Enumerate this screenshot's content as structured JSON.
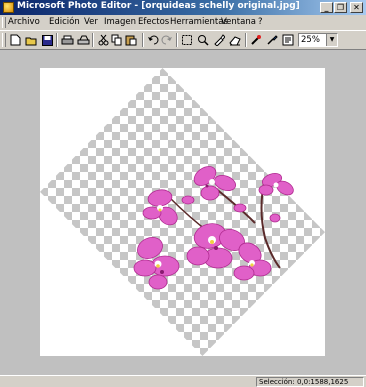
{
  "window": {
    "title": "Microsoft Photo Editor - [orquideas schelly original.jpg]",
    "controls": {
      "minimize": "_",
      "restore": "❐",
      "close": "✕"
    }
  },
  "menu": {
    "items": [
      "Archivo",
      "Edición",
      "Ver",
      "Imagen",
      "Efectos",
      "Herramientas",
      "Ventana",
      "?"
    ]
  },
  "toolbar": {
    "icons": [
      "new-icon",
      "open-icon",
      "save-icon",
      "print-icon",
      "scan-icon",
      "cut-icon",
      "copy-icon",
      "paste-icon",
      "undo-icon",
      "redo-icon",
      "select-icon",
      "zoom-icon",
      "smudge-icon",
      "eraser-icon",
      "color-picker-icon",
      "transparency-icon",
      "properties-icon"
    ],
    "zoom": "25%"
  },
  "status": {
    "selection": "Selección: 0,0:1588,1625"
  }
}
